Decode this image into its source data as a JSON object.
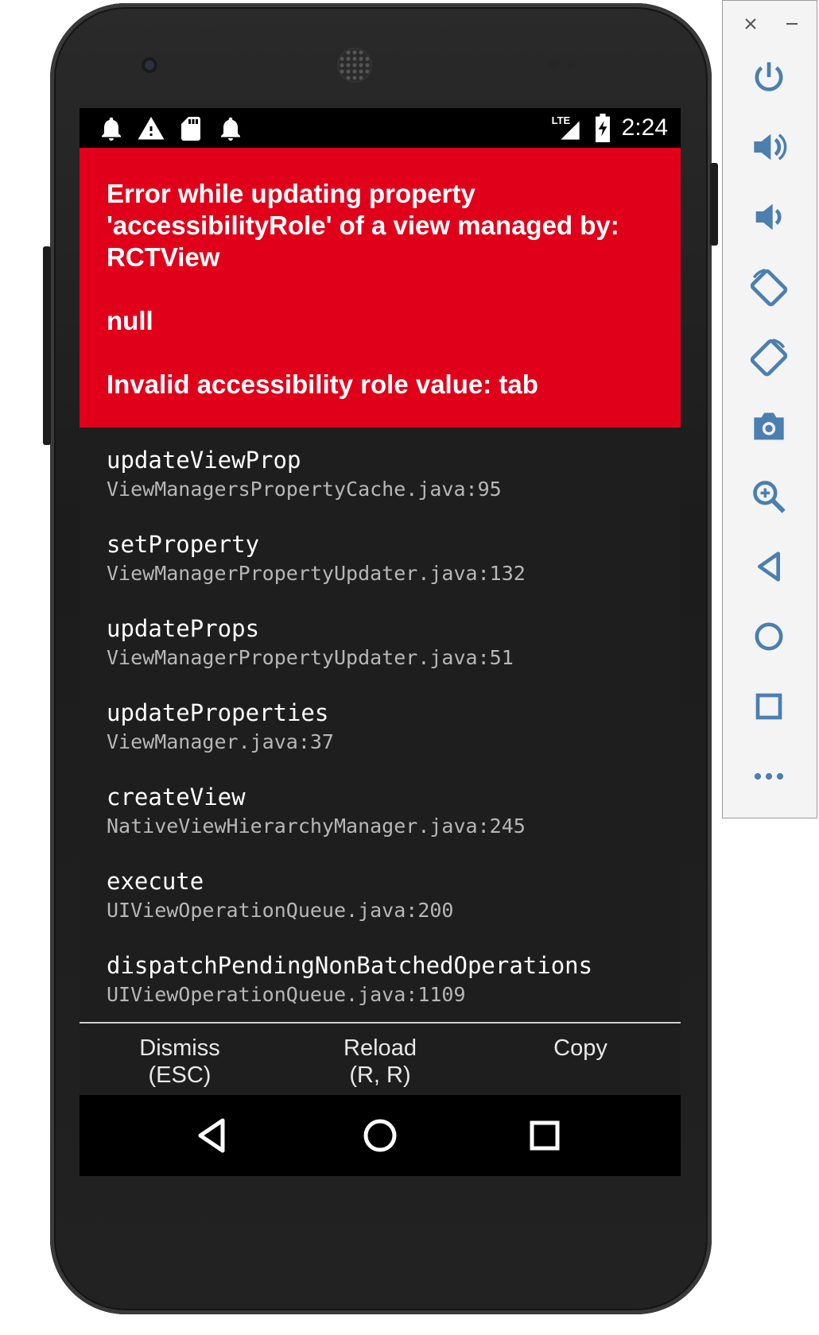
{
  "status_bar": {
    "time": "2:24",
    "network": "LTE",
    "left_icons": [
      "notification-bell-icon",
      "warning-icon",
      "sd-card-icon",
      "notification-bell-icon"
    ]
  },
  "error": {
    "title": "Error while updating property 'accessibilityRole' of a view managed by: RCTView",
    "detail": "null",
    "message": "Invalid accessibility role value: tab"
  },
  "stack_frames": [
    {
      "method": "updateViewProp",
      "file": "ViewManagersPropertyCache.java:95"
    },
    {
      "method": "setProperty",
      "file": "ViewManagerPropertyUpdater.java:132"
    },
    {
      "method": "updateProps",
      "file": "ViewManagerPropertyUpdater.java:51"
    },
    {
      "method": "updateProperties",
      "file": "ViewManager.java:37"
    },
    {
      "method": "createView",
      "file": "NativeViewHierarchyManager.java:245"
    },
    {
      "method": "execute",
      "file": "UIViewOperationQueue.java:200"
    },
    {
      "method": "dispatchPendingNonBatchedOperations",
      "file": "UIViewOperationQueue.java:1109"
    }
  ],
  "actions": {
    "dismiss": {
      "line1": "Dismiss",
      "line2": "(ESC)"
    },
    "reload": {
      "line1": "Reload",
      "line2": "(R, R)"
    },
    "copy": {
      "line1": "Copy",
      "line2": ""
    }
  },
  "nav_bar": [
    "back-icon",
    "home-icon",
    "recents-icon"
  ],
  "emulator_toolbar": {
    "window_controls": [
      "close-icon",
      "minimize-icon"
    ],
    "buttons": [
      "power-icon",
      "volume-up-icon",
      "volume-down-icon",
      "rotate-left-icon",
      "rotate-right-icon",
      "camera-icon",
      "zoom-icon",
      "back-icon",
      "home-icon",
      "overview-icon",
      "more-icon"
    ]
  },
  "colors": {
    "error_red": "#e0001a",
    "screen_bg": "#1e1e1f",
    "toolbar_icon": "#4a7fb0"
  }
}
